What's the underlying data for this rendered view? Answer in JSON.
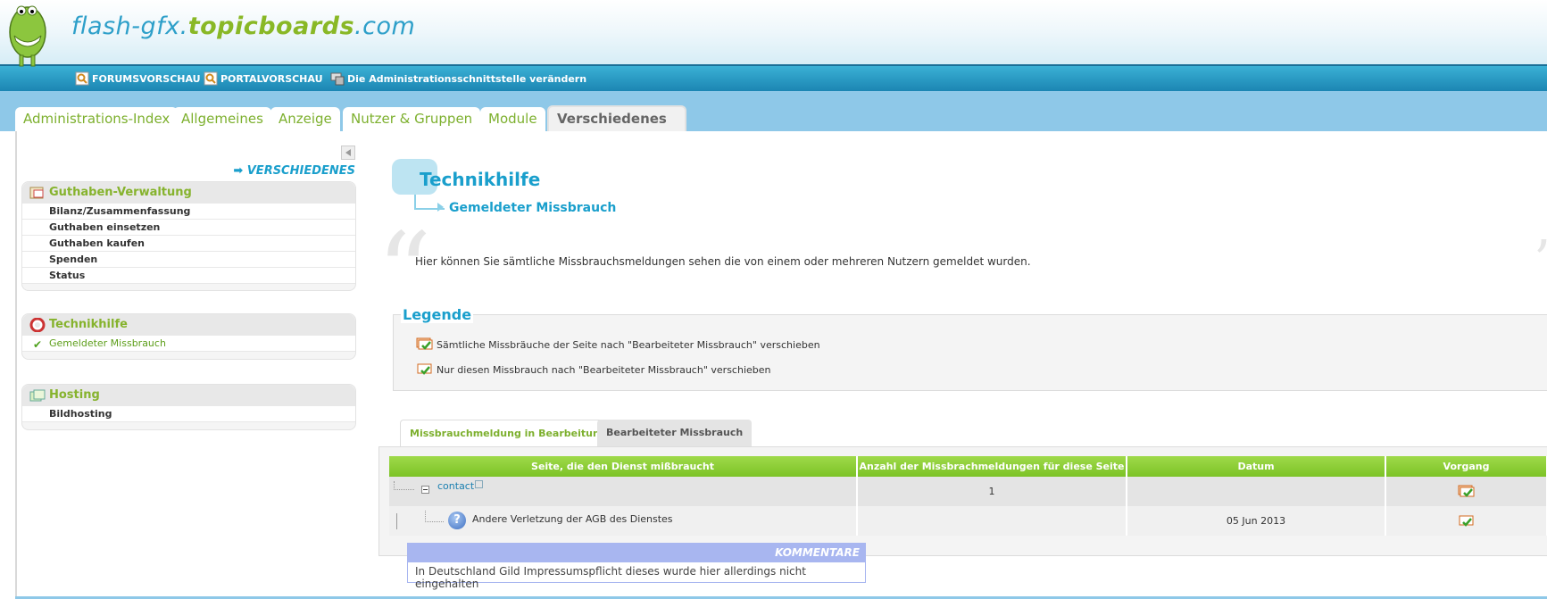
{
  "site": {
    "title_part1": "flash-gfx.",
    "title_part2": "topicboards",
    "title_part3": ".com"
  },
  "topbar": {
    "links": [
      {
        "label": "FORUMSVORSCHAU",
        "icon": "magnifier-icon"
      },
      {
        "label": "PORTALVORSCHAU",
        "icon": "magnifier-icon"
      },
      {
        "label": "Die Administrationsschnittstelle verändern",
        "icon": "computer-icon"
      }
    ]
  },
  "tabs": [
    {
      "label": "Administrations-Index",
      "active": false
    },
    {
      "label": "Allgemeines",
      "active": false
    },
    {
      "label": "Anzeige",
      "active": false
    },
    {
      "label": "Nutzer & Gruppen",
      "active": false
    },
    {
      "label": "Module",
      "active": false
    },
    {
      "label": "Verschiedenes",
      "active": true
    }
  ],
  "sidebar": {
    "heading": "➡ VERSCHIEDENES",
    "sections": [
      {
        "title": "Guthaben-Verwaltung",
        "icon": "credit-icon",
        "items": [
          "Bilanz/Zusammenfassung",
          "Guthaben einsetzen",
          "Guthaben kaufen",
          "Spenden",
          "Status"
        ]
      },
      {
        "title": "Technikhilfe",
        "icon": "lifebuoy-icon",
        "items": [
          "Gemeldeter Missbrauch"
        ],
        "selected": "Gemeldeter Missbrauch"
      },
      {
        "title": "Hosting",
        "icon": "images-icon",
        "items": [
          "Bildhosting"
        ]
      }
    ]
  },
  "main": {
    "title": "Technikhilfe",
    "subtitle": "Gemeldeter Missbrauch",
    "description": "Hier können Sie sämtliche Missbrauchsmeldungen sehen die von einem oder mehreren Nutzern gemeldet wurden.",
    "legend": {
      "title": "Legende",
      "items": [
        "Sämtliche Missbräuche der Seite nach \"Bearbeiteter Missbrauch\" verschieben",
        "Nur diesen Missbrauch nach \"Bearbeiteter Missbrauch\" verschieben"
      ]
    },
    "subtabs": [
      {
        "label": "Missbrauchmeldung in Bearbeitung",
        "active": true
      },
      {
        "label": "Bearbeiteter Missbrauch",
        "active": false
      }
    ],
    "table": {
      "headers": [
        "Seite, die den Dienst mißbraucht",
        "Anzahl der Missbrachmeldungen für diese Seite",
        "Datum",
        "Vorgang"
      ],
      "rows": [
        {
          "page": "contact",
          "count": "1",
          "date": ""
        },
        {
          "reason": "Andere Verletzung der AGB des Dienstes",
          "count": "",
          "date": "05 Jun 2013"
        }
      ]
    },
    "comment": {
      "heading": "KOMMENTARE",
      "text": "In Deutschland Gild Impressumspflicht dieses wurde hier allerdings nicht eingehalten"
    }
  },
  "colors": {
    "accent_blue": "#1a9fcc",
    "accent_green": "#86b32d",
    "topbar": "#1c86b3"
  }
}
